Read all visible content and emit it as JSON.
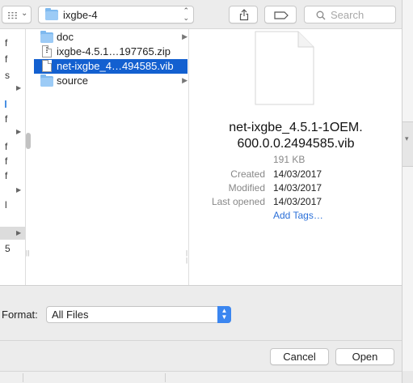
{
  "toolbar": {
    "location": "ixgbe-4",
    "search_placeholder": "Search"
  },
  "sidebar_fragments": [
    "f",
    "f",
    "s",
    "f",
    "f",
    "f",
    "f",
    "l",
    "5"
  ],
  "files": [
    {
      "name": "doc",
      "kind": "folder",
      "selected": false
    },
    {
      "name": "ixgbe-4.5.1…197765.zip",
      "kind": "zip",
      "selected": false
    },
    {
      "name": "net-ixgbe_4…494585.vib",
      "kind": "document",
      "selected": true
    },
    {
      "name": "source",
      "kind": "folder",
      "selected": false
    }
  ],
  "preview": {
    "name_line1": "net-ixgbe_4.5.1-1OEM.",
    "name_line2": "600.0.0.2494585.vib",
    "size": "191 KB",
    "created_label": "Created",
    "created_value": "14/03/2017",
    "modified_label": "Modified",
    "modified_value": "14/03/2017",
    "last_opened_label": "Last opened",
    "last_opened_value": "14/03/2017",
    "add_tags": "Add Tags…"
  },
  "format": {
    "label": "Format:",
    "value": "All Files"
  },
  "buttons": {
    "cancel": "Cancel",
    "open": "Open"
  },
  "colors": {
    "selection": "#1360d0",
    "accent": "#3b86f0",
    "link": "#2a6fd8"
  }
}
